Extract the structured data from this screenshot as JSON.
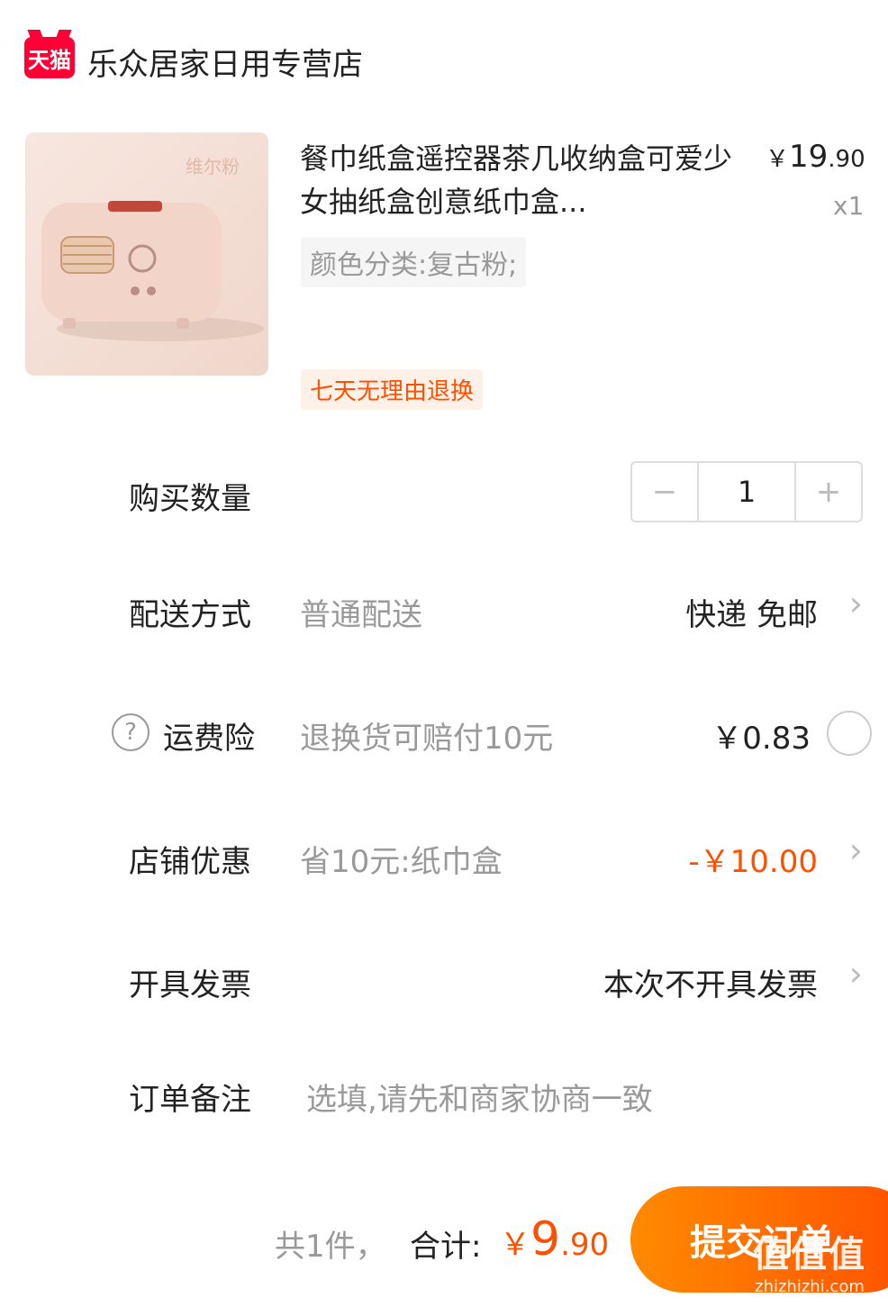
{
  "header": {
    "logo_text": "天猫",
    "store_name": "乐众居家日用专营店"
  },
  "product": {
    "image_label": "维尔粉",
    "title": "餐巾纸盒遥控器茶几收纳盒可爱少女抽纸盒创意纸巾盒...",
    "price_symbol": "￥",
    "price_int": "19",
    "price_dec": ".90",
    "quantity_text": "x1",
    "sku": "颜色分类:复古粉;",
    "tag": "七天无理由退换"
  },
  "quantity": {
    "label": "购买数量",
    "minus": "−",
    "value": "1",
    "plus": "+"
  },
  "delivery": {
    "label": "配送方式",
    "method": "普通配送",
    "value": "快递 免邮",
    "chevron": "›"
  },
  "insurance": {
    "help": "?",
    "label": "运费险",
    "desc": "退换货可赔付10元",
    "value": "￥0.83"
  },
  "discount": {
    "label": "店铺优惠",
    "desc": "省10元:纸巾盒",
    "value": "-￥10.00",
    "chevron": "›"
  },
  "invoice": {
    "label": "开具发票",
    "value": "本次不开具发票",
    "chevron": "›"
  },
  "note": {
    "label": "订单备注",
    "placeholder": "选填,请先和商家协商一致"
  },
  "footer": {
    "count": "共1件，",
    "total_label": "合计:",
    "total_symbol": "￥",
    "total_int": "9",
    "total_dec": ".90",
    "submit": "提交订单"
  },
  "watermark": {
    "big": "值值值",
    "small": "zhizhizhi.com"
  },
  "colors": {
    "accent": "#ff5000",
    "tmall_red": "#ff0036",
    "muted": "#999999"
  },
  "icons": [
    "tmall-logo-icon",
    "minus-icon",
    "plus-icon",
    "chevron-right-icon",
    "help-icon",
    "radio-icon"
  ]
}
